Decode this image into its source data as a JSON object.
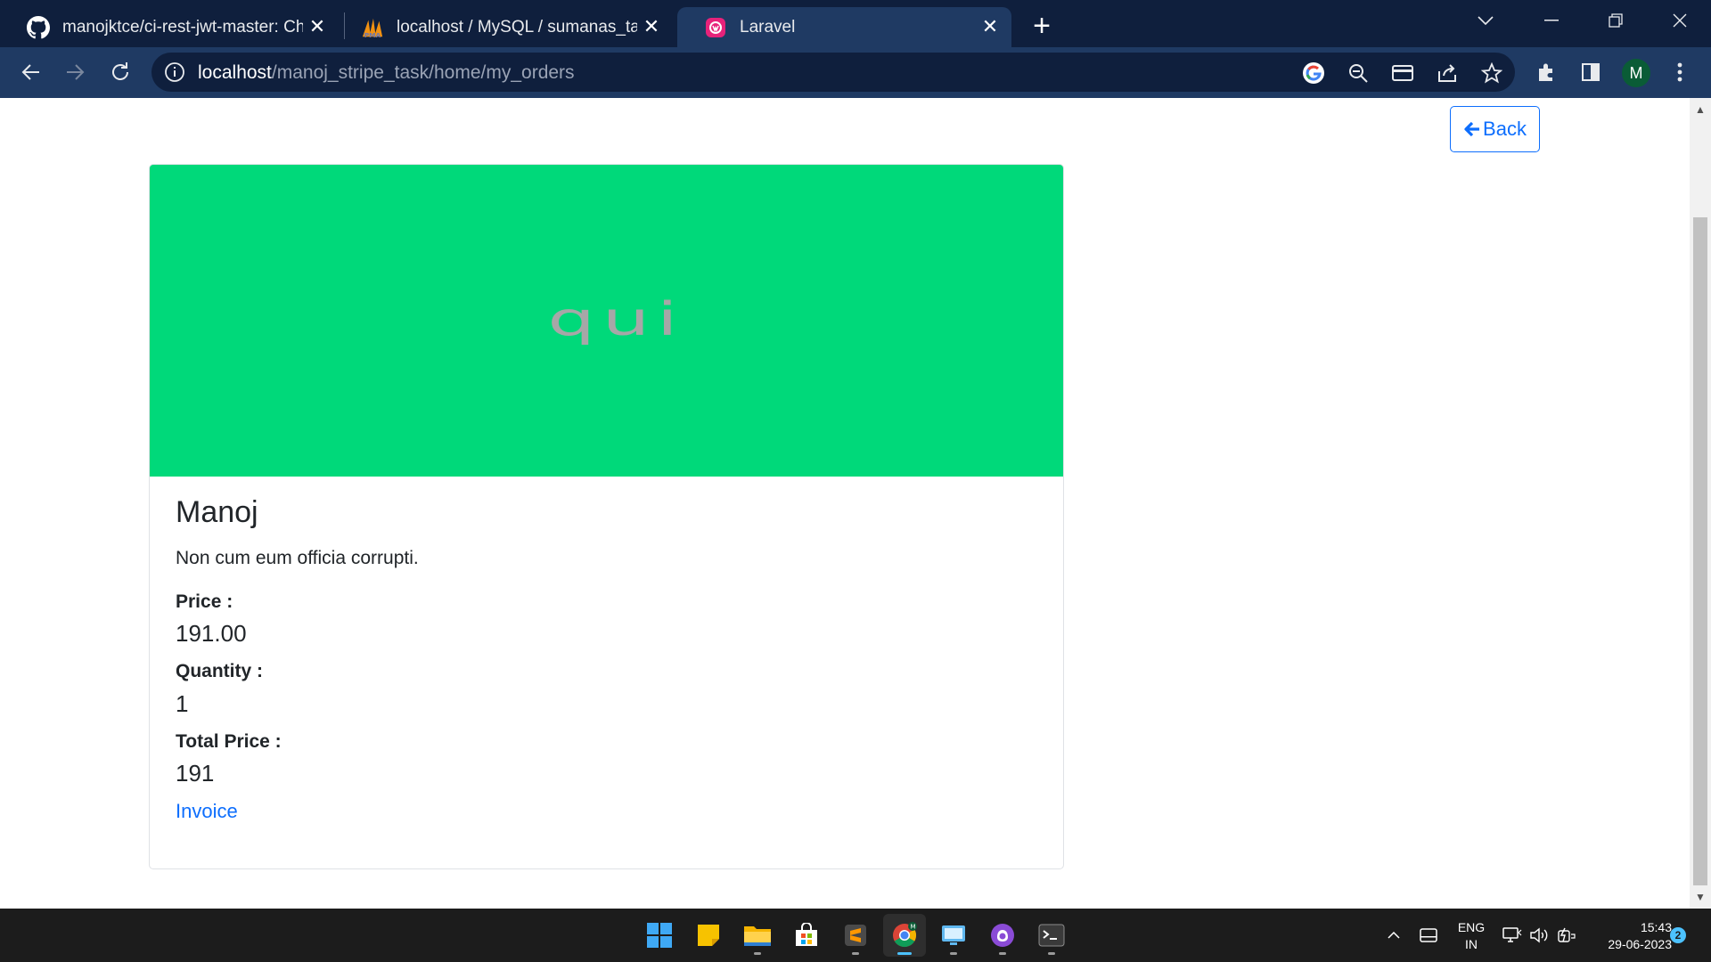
{
  "browser": {
    "tabs": [
      {
        "title": "manojktce/ci-rest-jwt-master: Ch",
        "icon": "github-icon"
      },
      {
        "title": "localhost / MySQL / sumanas_tas",
        "icon": "phpmyadmin-icon"
      },
      {
        "title": "Laravel",
        "icon": "laravel-icon",
        "active": true
      }
    ],
    "url": {
      "host": "localhost",
      "path": "/manoj_stripe_task/home/my_orders"
    },
    "profile_initial": "M"
  },
  "page": {
    "back_label": "Back",
    "product_image_text": "qui",
    "card": {
      "title": "Manoj",
      "description": "Non cum eum officia corrupti.",
      "price_label": "Price :",
      "price_value": "191.00",
      "quantity_label": "Quantity :",
      "quantity_value": "1",
      "total_label": "Total Price :",
      "total_value": "191",
      "invoice_label": "Invoice"
    }
  },
  "taskbar": {
    "apps": [
      "windows-start",
      "sticky-notes",
      "file-explorer",
      "microsoft-store",
      "sublime-text",
      "chrome",
      "remote-desktop",
      "github-desktop",
      "terminal"
    ],
    "language": {
      "line1": "ENG",
      "line2": "IN"
    },
    "time": "15:43",
    "date": "29-06-2023",
    "notification_count": "2"
  },
  "colors": {
    "chrome_dark": "#0f1f3d",
    "chrome_toolbar": "#1f3a63",
    "image_bg": "#00d97a",
    "link": "#0d6efd"
  }
}
